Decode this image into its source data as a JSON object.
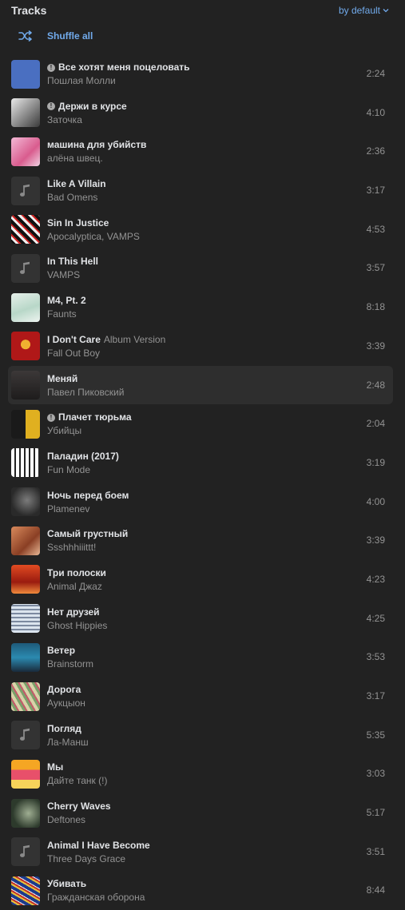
{
  "header": {
    "title": "Tracks",
    "sort_label": "by default"
  },
  "shuffle": {
    "label": "Shuffle all"
  },
  "colors": {
    "accent": "#71aaeb",
    "background": "#222222",
    "active_row": "#2e2e2e"
  },
  "tracks": [
    {
      "title": "Все хотят меня поцеловать",
      "subtitle": "",
      "artist": "Пошлая Молли",
      "duration": "2:24",
      "explicit": true,
      "cover": "c1"
    },
    {
      "title": "Держи в курсе",
      "subtitle": "",
      "artist": "Заточка",
      "duration": "4:10",
      "explicit": true,
      "cover": "c2"
    },
    {
      "title": "машина для убийств",
      "subtitle": "",
      "artist": "алёна швец.",
      "duration": "2:36",
      "explicit": false,
      "cover": "c3"
    },
    {
      "title": "Like A Villain",
      "subtitle": "",
      "artist": "Bad Omens",
      "duration": "3:17",
      "explicit": false,
      "cover": "placeholder"
    },
    {
      "title": "Sin In Justice",
      "subtitle": "",
      "artist": "Apocalyptica, VAMPS",
      "duration": "4:53",
      "explicit": false,
      "cover": "c5"
    },
    {
      "title": "In This Hell",
      "subtitle": "",
      "artist": "VAMPS",
      "duration": "3:57",
      "explicit": false,
      "cover": "placeholder"
    },
    {
      "title": "M4, Pt. 2",
      "subtitle": "",
      "artist": "Faunts",
      "duration": "8:18",
      "explicit": false,
      "cover": "c7"
    },
    {
      "title": "I Don't Care",
      "subtitle": "Album Version",
      "artist": "Fall Out Boy",
      "duration": "3:39",
      "explicit": false,
      "cover": "c8"
    },
    {
      "title": "Меняй",
      "subtitle": "",
      "artist": "Павел Пиковский",
      "duration": "2:48",
      "explicit": false,
      "cover": "c9"
    },
    {
      "title": "Плачет тюрьма",
      "subtitle": "",
      "artist": "Убийцы",
      "duration": "2:04",
      "explicit": true,
      "cover": "c10"
    },
    {
      "title": "Паладин (2017)",
      "subtitle": "",
      "artist": "Fun Mode",
      "duration": "3:19",
      "explicit": false,
      "cover": "c11"
    },
    {
      "title": "Ночь перед боем",
      "subtitle": "",
      "artist": "Plamenev",
      "duration": "4:00",
      "explicit": false,
      "cover": "c12"
    },
    {
      "title": "Самый грустный",
      "subtitle": "",
      "artist": "Ssshhhiiittt!",
      "duration": "3:39",
      "explicit": false,
      "cover": "c13"
    },
    {
      "title": "Три полоски",
      "subtitle": "",
      "artist": "Animal Джаz",
      "duration": "4:23",
      "explicit": false,
      "cover": "c14"
    },
    {
      "title": "Нет друзей",
      "subtitle": "",
      "artist": "Ghost Hippies",
      "duration": "4:25",
      "explicit": false,
      "cover": "c15"
    },
    {
      "title": "Ветер",
      "subtitle": "",
      "artist": "Brainstorm",
      "duration": "3:53",
      "explicit": false,
      "cover": "c16"
    },
    {
      "title": "Дорога",
      "subtitle": "",
      "artist": "Аукцыон",
      "duration": "3:17",
      "explicit": false,
      "cover": "c17"
    },
    {
      "title": "Погляд",
      "subtitle": "",
      "artist": "Ла-Манш",
      "duration": "5:35",
      "explicit": false,
      "cover": "placeholder"
    },
    {
      "title": "Мы",
      "subtitle": "",
      "artist": "Дайте танк (!)",
      "duration": "3:03",
      "explicit": false,
      "cover": "c19"
    },
    {
      "title": "Cherry Waves",
      "subtitle": "",
      "artist": "Deftones",
      "duration": "5:17",
      "explicit": false,
      "cover": "c20"
    },
    {
      "title": "Animal I Have Become",
      "subtitle": "",
      "artist": "Three Days Grace",
      "duration": "3:51",
      "explicit": false,
      "cover": "placeholder"
    },
    {
      "title": "Убивать",
      "subtitle": "",
      "artist": "Гражданская оборона",
      "duration": "8:44",
      "explicit": false,
      "cover": "c22"
    }
  ],
  "active_index": 8
}
